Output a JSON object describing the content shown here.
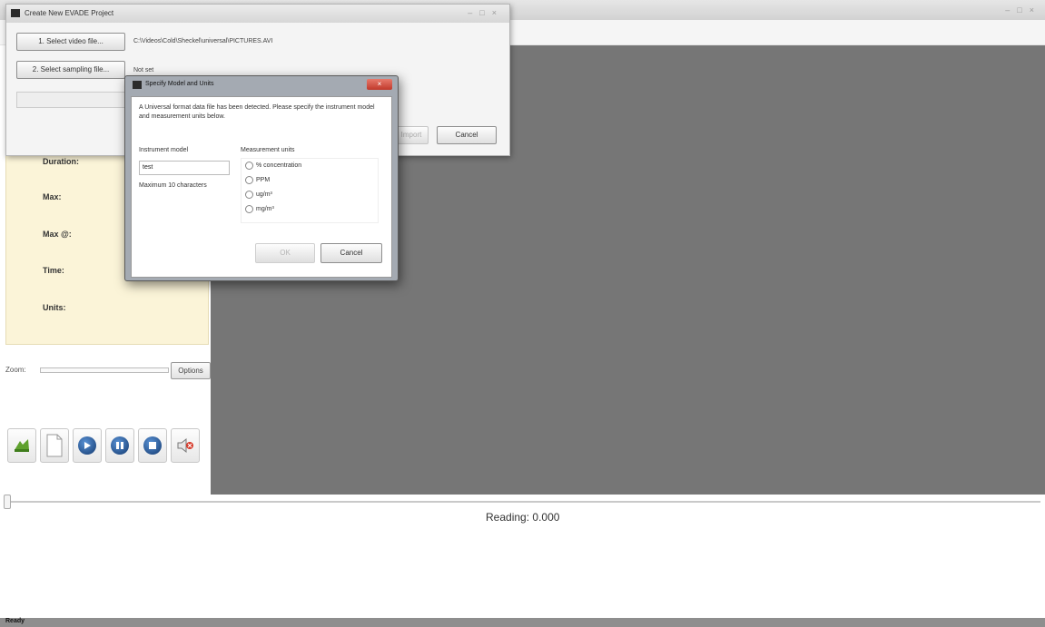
{
  "main_window": {
    "title_controls": [
      "–",
      "□",
      "×"
    ]
  },
  "info_panel": {
    "labels": [
      "Duration:",
      "Max:",
      "Max @:",
      "Time:",
      "Units:"
    ]
  },
  "zoom": {
    "label": "Zoom:",
    "options_label": "Options"
  },
  "toolbar": {
    "icons": [
      "open-folder-icon",
      "new-document-icon",
      "play-icon",
      "pause-icon",
      "stop-icon",
      "mute-icon"
    ]
  },
  "reading": {
    "label": "Reading:",
    "value": "0.000"
  },
  "status_bar": {
    "text": "Ready"
  },
  "create_dialog": {
    "title": "Create New EVADE Project",
    "title_controls": [
      "–",
      "□",
      "×"
    ],
    "select_video_label": "1. Select video file...",
    "video_path": "C:\\Videos\\Cold\\Sheckel\\universal\\PICTURES.AVI",
    "select_sampling_label": "2. Select sampling file...",
    "sampling_path": "Not set",
    "ok_label": "Import",
    "cancel_label": "Cancel"
  },
  "specify_dialog": {
    "title": "Specify Model and Units",
    "close_label": "×",
    "message": "A Universal format data file has been detected. Please specify the instrument model and measurement units below.",
    "model_label": "Instrument model",
    "model_value": "test",
    "model_hint": "Maximum 10 characters",
    "units_label": "Measurement units",
    "units_options": [
      "% concentration",
      "PPM",
      "ug/m³",
      "mg/m³"
    ],
    "ok_label": "OK",
    "cancel_label": "Cancel"
  }
}
